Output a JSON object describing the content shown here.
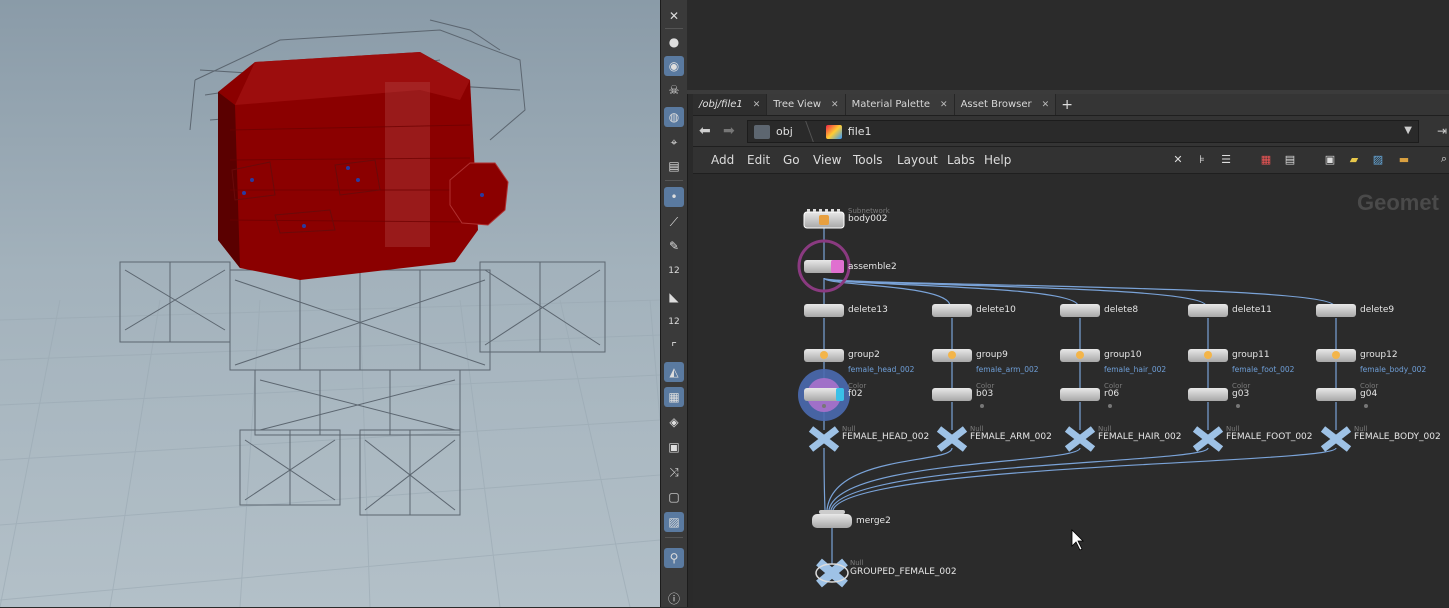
{
  "tabs": [
    {
      "label": "/obj/file1",
      "active": true
    },
    {
      "label": "Tree View",
      "active": false
    },
    {
      "label": "Material Palette",
      "active": false
    },
    {
      "label": "Asset Browser",
      "active": false
    }
  ],
  "path": {
    "crumbs": [
      "obj",
      "file1"
    ]
  },
  "menu": [
    "Add",
    "Edit",
    "Go",
    "View",
    "Tools",
    "Layout",
    "Labs",
    "Help"
  ],
  "network": {
    "context_label": "Geomet",
    "top_node": {
      "type": "Subnetwork",
      "name": "body002"
    },
    "assemble": {
      "name": "assemble2"
    },
    "columns": [
      {
        "delete": "delete13",
        "group": "group2",
        "group_sub": "female_head_002",
        "color": "f02",
        "null": "FEMALE_HEAD_002"
      },
      {
        "delete": "delete10",
        "group": "group9",
        "group_sub": "female_arm_002",
        "color": "b03",
        "null": "FEMALE_ARM_002"
      },
      {
        "delete": "delete8",
        "group": "group10",
        "group_sub": "female_hair_002",
        "color": "r06",
        "null": "FEMALE_HAIR_002"
      },
      {
        "delete": "delete11",
        "group": "group11",
        "group_sub": "female_foot_002",
        "color": "g03",
        "null": "FEMALE_FOOT_002"
      },
      {
        "delete": "delete9",
        "group": "group12",
        "group_sub": "female_body_002",
        "color": "g04",
        "null": "FEMALE_BODY_002"
      }
    ],
    "color_type": "Color",
    "null_type": "Null",
    "merge": {
      "name": "merge2"
    },
    "output": {
      "type": "Null",
      "name": "GROUPED_FEMALE_002"
    }
  },
  "shelf_icons": [
    "close-icon",
    "sphere-icon",
    "light-icon",
    "skull-icon",
    "camera-icon",
    "select-icon",
    "view-icon",
    "dot-icon",
    "brush-icon",
    "pen-icon",
    "number-icon",
    "eraser-icon",
    "number-icon",
    "corner-icon",
    "triangle-icon",
    "checker-icon",
    "layer-icon",
    "cube-icon",
    "graph-icon",
    "frame-icon",
    "image-icon",
    "pin-icon",
    "info-icon"
  ],
  "colors": {
    "accent": "#5a7aa0",
    "wire": "#7aa3d8",
    "mesh": "#8b0000"
  }
}
